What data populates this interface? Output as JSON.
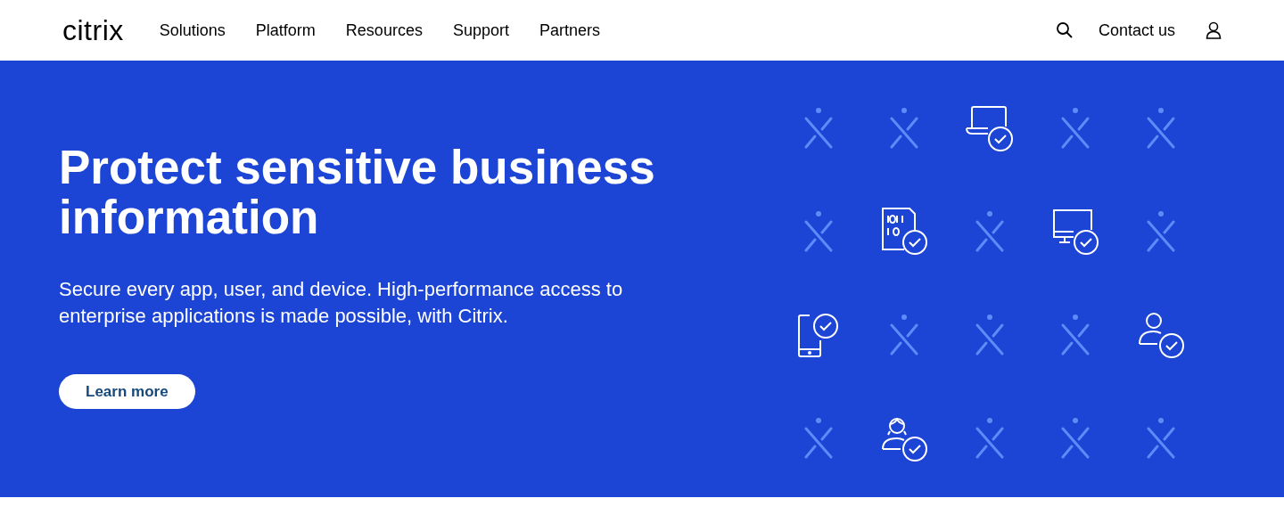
{
  "header": {
    "logo": "citrix",
    "nav": [
      "Solutions",
      "Platform",
      "Resources",
      "Support",
      "Partners"
    ],
    "contact": "Contact us"
  },
  "hero": {
    "title": "Protect sensitive business information",
    "subtitle": "Secure every app, user, and device. High-performance access to enterprise applications is made possible, with Citrix.",
    "button": "Learn more"
  },
  "icons": [
    {
      "kind": "mark"
    },
    {
      "kind": "mark"
    },
    {
      "kind": "laptop"
    },
    {
      "kind": "mark"
    },
    {
      "kind": "mark"
    },
    {
      "kind": "mark"
    },
    {
      "kind": "file"
    },
    {
      "kind": "mark"
    },
    {
      "kind": "monitor"
    },
    {
      "kind": "mark"
    },
    {
      "kind": "phone"
    },
    {
      "kind": "mark"
    },
    {
      "kind": "mark"
    },
    {
      "kind": "mark"
    },
    {
      "kind": "user"
    },
    {
      "kind": "mark"
    },
    {
      "kind": "person"
    },
    {
      "kind": "mark"
    },
    {
      "kind": "mark"
    },
    {
      "kind": "mark"
    }
  ]
}
